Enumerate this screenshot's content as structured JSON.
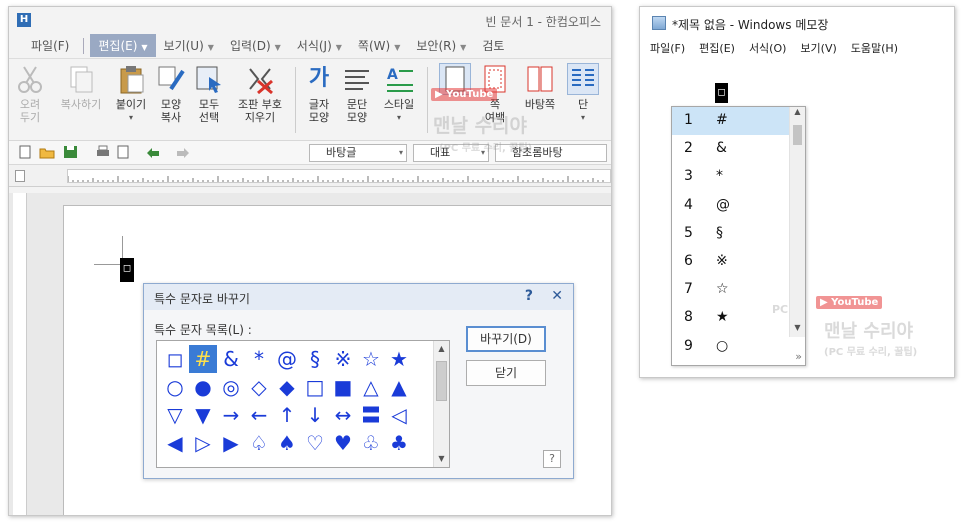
{
  "hwp": {
    "title": "빈 문서 1 - 한컴오피스",
    "menus": [
      {
        "label": "파일(F)",
        "active": false
      },
      {
        "label": "편집(E)",
        "active": true
      },
      {
        "label": "보기(U)",
        "active": false
      },
      {
        "label": "입력(D)",
        "active": false
      },
      {
        "label": "서식(J)",
        "active": false
      },
      {
        "label": "쪽(W)",
        "active": false
      },
      {
        "label": "보안(R)",
        "active": false
      },
      {
        "label": "검토",
        "active": false
      }
    ],
    "ribbon": {
      "cut": "오려\n두기",
      "copy": "복사하기",
      "paste": "붙이기",
      "format_copy": "모양\n복사",
      "select_all": "모두\n선택",
      "clear_format": "조판 부호\n지우기",
      "char_shape": "글자\n모양",
      "para_shape": "문단\n모양",
      "style": "스타일",
      "page_margin": "쪽\n여백",
      "page_bg": "바탕쪽",
      "column": "단"
    },
    "toolbar": {
      "style_combo": "바탕글",
      "font_lang_combo": "대표",
      "font_combo": "함초롬바탕"
    }
  },
  "dialog": {
    "title": "특수 문자로 바꾸기",
    "help": "?",
    "close": "✕",
    "list_label": "특수 문자 목록(L) :",
    "replace_button": "바꾸기(D)",
    "close_button": "닫기",
    "corner_help": "?",
    "symbols": [
      "◻",
      "#",
      "&",
      "*",
      "@",
      "§",
      "※",
      "☆",
      "★",
      "○",
      "●",
      "◎",
      "◇",
      "◆",
      "□",
      "■",
      "△",
      "▲",
      "▽",
      "▼",
      "→",
      "←",
      "↑",
      "↓",
      "↔",
      "〓",
      "◁",
      "◀",
      "▷",
      "▶",
      "♤",
      "♠",
      "♡",
      "♥",
      "♧",
      "♣"
    ],
    "selected_index": 1
  },
  "document": {
    "cursor_char": "◻"
  },
  "notepad": {
    "title": "*제목 없음 - Windows 메모장",
    "menus": [
      "파일(F)",
      "편집(E)",
      "서식(O)",
      "보기(V)",
      "도움말(H)"
    ],
    "caret_char": "◻",
    "candidates": [
      {
        "num": "1",
        "sym": "#"
      },
      {
        "num": "2",
        "sym": "&"
      },
      {
        "num": "3",
        "sym": "*"
      },
      {
        "num": "4",
        "sym": "@"
      },
      {
        "num": "5",
        "sym": "§"
      },
      {
        "num": "6",
        "sym": "※"
      },
      {
        "num": "7",
        "sym": "☆"
      },
      {
        "num": "8",
        "sym": "★"
      },
      {
        "num": "9",
        "sym": "○"
      }
    ],
    "selected_candidate": 0,
    "more": "»"
  },
  "watermark": {
    "brand": "맨날 수리야",
    "sub": "(PC 무료 수리, 꿀팁)",
    "youtube": "▶ YouTube",
    "pc": "PC"
  },
  "colors": {
    "symbol_blue": "#1a3bd8",
    "selected_cell_bg": "#3a7bd5",
    "selected_cell_fg": "#ffe14a",
    "menu_active_bg": "#9aa9c3"
  }
}
